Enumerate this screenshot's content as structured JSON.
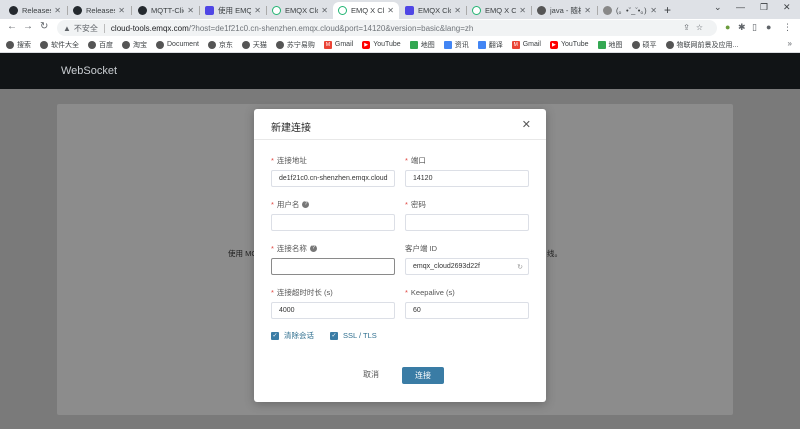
{
  "browser": {
    "tabs": [
      {
        "title": "Releases ·",
        "icon": "github-icon",
        "color": "#24292e"
      },
      {
        "title": "Releases ·",
        "icon": "github-icon",
        "color": "#24292e"
      },
      {
        "title": "MQTT-Clie",
        "icon": "github-icon",
        "color": "#24292e"
      },
      {
        "title": "使用 EMQX",
        "icon": "emqx-icon",
        "color": "#4f46e5"
      },
      {
        "title": "EMQX Clou",
        "icon": "emqx-cloud-icon",
        "color": "#22b573"
      },
      {
        "title": "EMQ X Clo",
        "icon": "emqx-cloud-icon",
        "color": "#22b573"
      },
      {
        "title": "EMQX Clou",
        "icon": "emqx-icon",
        "color": "#4f46e5"
      },
      {
        "title": "EMQ X Clo",
        "icon": "emqx-cloud-icon",
        "color": "#22b573"
      },
      {
        "title": "java - 随机",
        "icon": "csdn-icon",
        "color": "#555"
      },
      {
        "title": "(。•ˇ_ˇ•。) li",
        "icon": "page-icon",
        "color": "#888"
      }
    ],
    "active_tab_index": 5,
    "address": {
      "insecure_label": "不安全",
      "host": "cloud-tools.emqx.com",
      "path": "/?host=de1f21c0.cn-shenzhen.emqx.cloud&port=14120&version=basic&lang=zh"
    },
    "bookmarks": [
      {
        "label": "搜索",
        "color": "#555"
      },
      {
        "label": "软件大全",
        "color": "#555"
      },
      {
        "label": "百度",
        "color": "#555"
      },
      {
        "label": "淘宝",
        "color": "#555"
      },
      {
        "label": "Document",
        "color": "#555"
      },
      {
        "label": "京东",
        "color": "#555"
      },
      {
        "label": "天猫",
        "color": "#555"
      },
      {
        "label": "苏宁易购",
        "color": "#555"
      },
      {
        "label": "Gmail",
        "color": "#ea4335"
      },
      {
        "label": "YouTube",
        "color": "#ff0000"
      },
      {
        "label": "地图",
        "color": "#34a853"
      },
      {
        "label": "资讯",
        "color": "#4285f4"
      },
      {
        "label": "翻译",
        "color": "#4285f4"
      },
      {
        "label": "Gmail",
        "color": "#ea4335"
      },
      {
        "label": "YouTube",
        "color": "#ff0000"
      },
      {
        "label": "地图",
        "color": "#34a853"
      },
      {
        "label": "硕平",
        "color": "#555"
      },
      {
        "label": "物联网前景及应用...",
        "color": "#555"
      }
    ]
  },
  "app": {
    "title": "WebSocket",
    "panel_text_left": "使用 MC",
    "panel_text_right": "线。"
  },
  "modal": {
    "title": "新建连接",
    "fields": {
      "host": {
        "label": "连接地址",
        "value": "de1f21c0.cn-shenzhen.emqx.cloud"
      },
      "port": {
        "label": "端口",
        "value": "14120"
      },
      "username": {
        "label": "用户名",
        "value": ""
      },
      "password": {
        "label": "密码",
        "value": ""
      },
      "name": {
        "label": "连接名称",
        "value": ""
      },
      "client_id": {
        "label": "客户端 ID",
        "value": "emqx_cloud2693d22f"
      },
      "timeout": {
        "label": "连接超时时长 (s)",
        "value": "4000"
      },
      "keepalive": {
        "label": "Keepalive (s)",
        "value": "60"
      }
    },
    "checkboxes": {
      "clean_session": {
        "label": "清除会话",
        "checked": true
      },
      "ssl": {
        "label": "SSL / TLS",
        "checked": true
      }
    },
    "cancel_label": "取消",
    "ok_label": "连接"
  }
}
